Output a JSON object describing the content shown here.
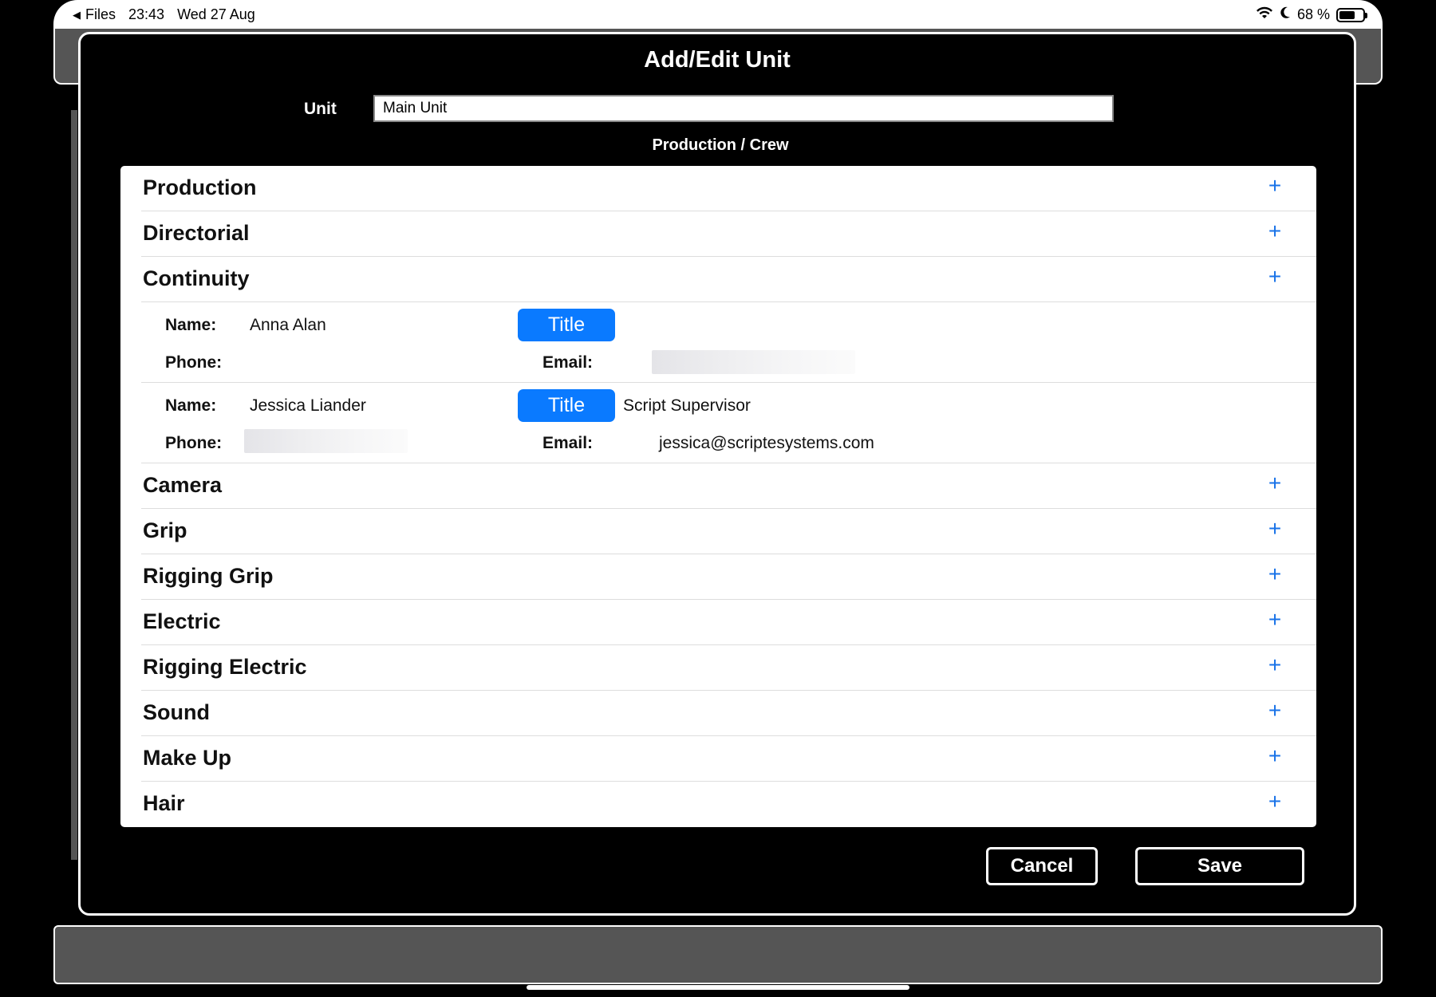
{
  "statusbar": {
    "back_app": "Files",
    "time": "23:43",
    "date": "Wed 27 Aug",
    "battery_percent": "68 %",
    "battery_level": 0.68
  },
  "modal": {
    "title": "Add/Edit Unit",
    "unit_label": "Unit",
    "unit_value": "Main Unit",
    "section_heading": "Production / Crew"
  },
  "groups_before": [
    {
      "name": "Production"
    },
    {
      "name": "Directorial"
    },
    {
      "name": "Continuity"
    }
  ],
  "members": [
    {
      "name_label": "Name:",
      "name": "Anna Alan",
      "title_button": "Title",
      "title": "",
      "phone_label": "Phone:",
      "phone": "",
      "email_label": "Email:",
      "email": ""
    },
    {
      "name_label": "Name:",
      "name": "Jessica Liander",
      "title_button": "Title",
      "title": "Script Supervisor",
      "phone_label": "Phone:",
      "phone": "",
      "email_label": "Email:",
      "email": "jessica@scriptesystems.com"
    }
  ],
  "groups_after": [
    {
      "name": "Camera"
    },
    {
      "name": "Grip"
    },
    {
      "name": "Rigging Grip"
    },
    {
      "name": "Electric"
    },
    {
      "name": "Rigging Electric"
    },
    {
      "name": "Sound"
    },
    {
      "name": "Make Up"
    },
    {
      "name": "Hair"
    }
  ],
  "plus_symbol": "+",
  "buttons": {
    "cancel": "Cancel",
    "save": "Save"
  },
  "colors": {
    "accent": "#0a7aff",
    "plus": "#1a73e8",
    "chrome": "#555555"
  }
}
